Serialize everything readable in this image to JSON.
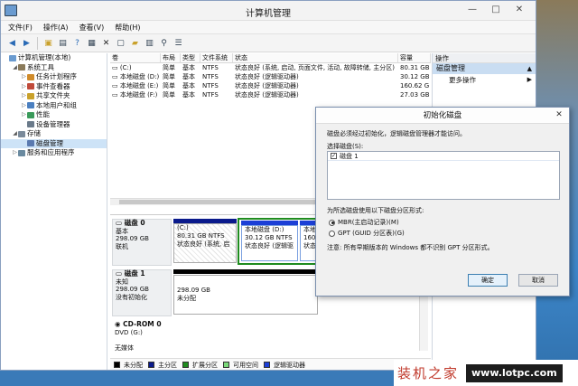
{
  "window": {
    "title": "计算机管理",
    "controls": [
      "—",
      "□",
      "✕"
    ]
  },
  "menu": [
    "文件(F)",
    "操作(A)",
    "查看(V)",
    "帮助(H)"
  ],
  "toolbar_icons": [
    "back-icon",
    "forward-icon",
    "up-folder-icon",
    "show-tree-icon",
    "help-icon",
    "properties-icon",
    "delete-icon",
    "new-icon",
    "open-icon",
    "save-icon",
    "search-icon",
    "list-icon"
  ],
  "tree": [
    {
      "label": "计算机管理(本地)",
      "indent": 0,
      "twisty": ""
    },
    {
      "label": "系统工具",
      "indent": 1,
      "twisty": "◢"
    },
    {
      "label": "任务计划程序",
      "indent": 2,
      "twisty": "▷"
    },
    {
      "label": "事件查看器",
      "indent": 2,
      "twisty": "▷"
    },
    {
      "label": "共享文件夹",
      "indent": 2,
      "twisty": "▷"
    },
    {
      "label": "本地用户和组",
      "indent": 2,
      "twisty": "▷"
    },
    {
      "label": "性能",
      "indent": 2,
      "twisty": "▷"
    },
    {
      "label": "设备管理器",
      "indent": 2,
      "twisty": ""
    },
    {
      "label": "存储",
      "indent": 1,
      "twisty": "◢"
    },
    {
      "label": "磁盘管理",
      "indent": 2,
      "twisty": "",
      "selected": true
    },
    {
      "label": "服务和应用程序",
      "indent": 1,
      "twisty": "▷"
    }
  ],
  "volume_table": {
    "headers": [
      "卷",
      "布局",
      "类型",
      "文件系统",
      "状态",
      "容量"
    ],
    "rows": [
      [
        "(C:)",
        "简单",
        "基本",
        "NTFS",
        "状态良好 (系统, 启动, 页面文件, 活动, 故障转储, 主分区)",
        "80.31 GB"
      ],
      [
        "本地磁盘 (D:)",
        "简单",
        "基本",
        "NTFS",
        "状态良好 (逻辑驱动器)",
        "30.12 GB"
      ],
      [
        "本地磁盘 (E:)",
        "简单",
        "基本",
        "NTFS",
        "状态良好 (逻辑驱动器)",
        "160.62 G"
      ],
      [
        "本地磁盘 (F:)",
        "简单",
        "基本",
        "NTFS",
        "状态良好 (逻辑驱动器)",
        "27.03 GB"
      ]
    ]
  },
  "disks": {
    "disk0": {
      "name": "磁盘 0",
      "type": "基本",
      "size": "298.09 GB",
      "status": "联机",
      "parts": [
        {
          "l1": "(C:)",
          "l2": "80.31 GB NTFS",
          "l3": "状态良好 (系统, 启"
        },
        {
          "l1": "本地磁盘  (D:)",
          "l2": "30.12 GB NTFS",
          "l3": "状态良好 (逻辑驱"
        },
        {
          "l1": "本地磁盘",
          "l2": "160.62",
          "l3": "状态良"
        }
      ]
    },
    "disk1": {
      "name": "磁盘 1",
      "type": "未知",
      "size": "298.09 GB",
      "status": "没有初始化",
      "part_size": "298.09 GB",
      "part_status": "未分配"
    },
    "cdrom": {
      "name": "CD-ROM 0",
      "drive": "DVD (G:)",
      "media": "无媒体"
    }
  },
  "legend": [
    {
      "label": "未分配",
      "color": "#000000"
    },
    {
      "label": "主分区",
      "color": "#0a1a8c"
    },
    {
      "label": "扩展分区",
      "color": "#1f8c1f"
    },
    {
      "label": "可用空间",
      "color": "#7ad97a"
    },
    {
      "label": "逻辑驱动器",
      "color": "#1c3fd6"
    }
  ],
  "actions": {
    "header": "操作",
    "section": "磁盘管理",
    "more": "更多操作"
  },
  "dialog": {
    "title": "初始化磁盘",
    "intro": "磁盘必须经过初始化，逻辑磁盘管理器才能访问。",
    "select_label": "选择磁盘(S):",
    "disk_item": "磁盘 1",
    "style_label": "为所选磁盘使用以下磁盘分区形式:",
    "mbr": "MBR(主启动记录)(M)",
    "gpt": "GPT (GUID 分区表)(G)",
    "note": "注意: 所有早期版本的 Windows 都不识别 GPT 分区形式。",
    "ok": "确定",
    "cancel": "取消"
  },
  "watermark": {
    "cn": "装机之家",
    "url": "www.lotpc.com"
  }
}
